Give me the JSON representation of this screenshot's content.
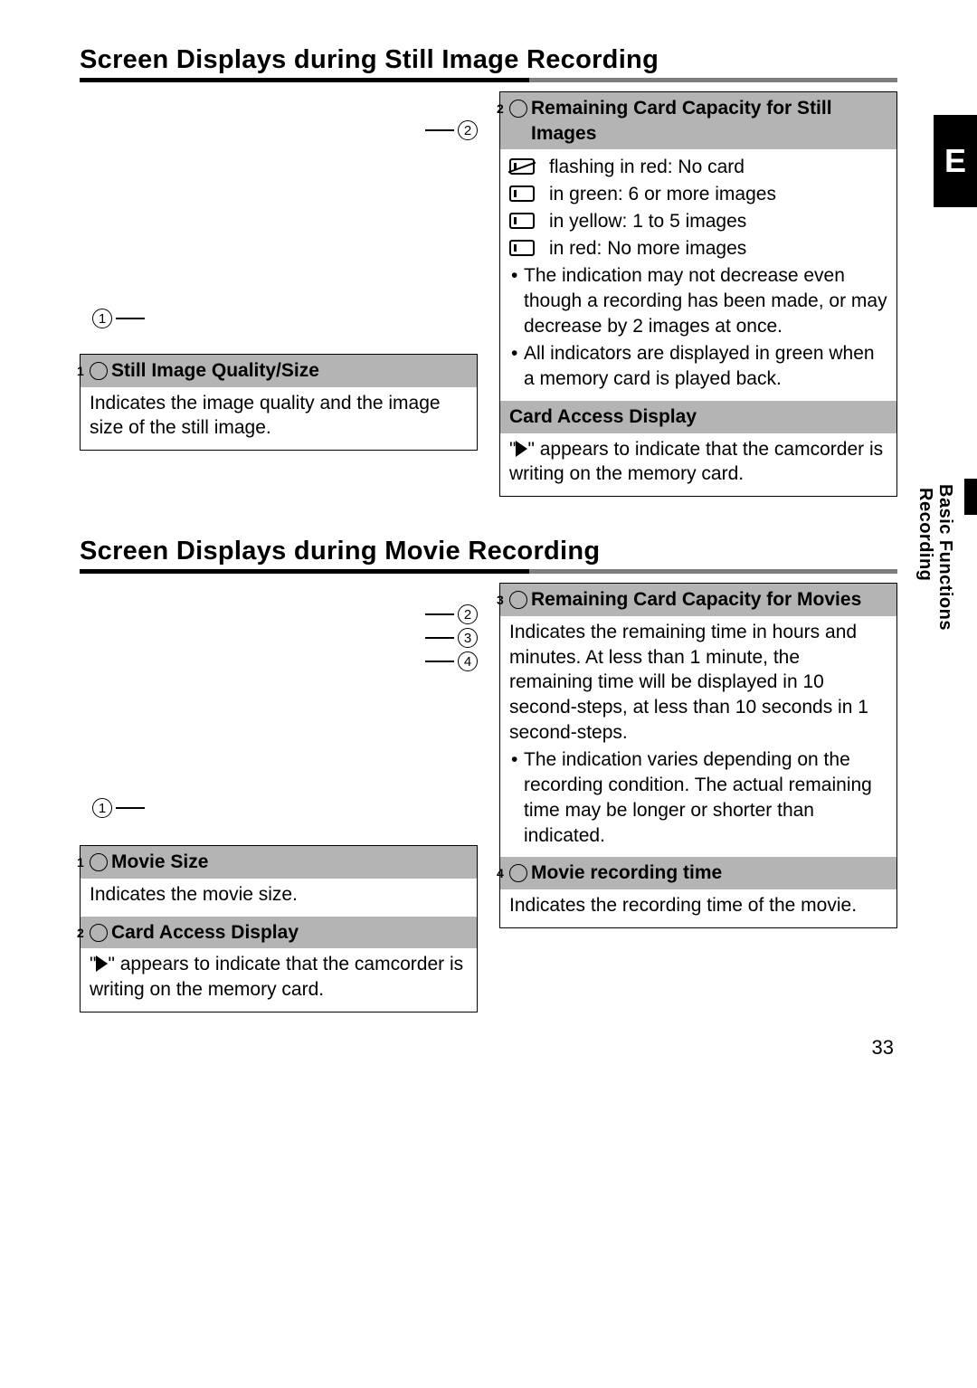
{
  "page_number": "33",
  "edge_tab": "E",
  "side": {
    "line1": "Basic Functions",
    "line2": "Recording"
  },
  "still": {
    "heading": "Screen Displays during Still Image Recording",
    "callouts": {
      "c1": "1",
      "c2": "2"
    },
    "left": {
      "q_title_num": "1",
      "q_title": "Still Image Quality/Size",
      "q_body": "Indicates the image quality and the image size of the still image."
    },
    "right": {
      "cap_title_num": "2",
      "cap_title": "Remaining Card Capacity for Still Images",
      "cap_list": [
        "flashing in red: No card",
        "in green: 6 or more images",
        "in yellow: 1 to 5 images",
        "in red: No more images"
      ],
      "cap_notes": [
        "The indication may not decrease even though a recording has been made, or may decrease by 2 images at once.",
        "All indicators are displayed in green when a memory card is played back."
      ],
      "access_title": "Card Access Display",
      "access_body_pre": "\"",
      "access_body_post": "\" appears to indicate that the camcorder is writing on the memory card."
    }
  },
  "movie": {
    "heading": "Screen Displays during Movie Recording",
    "callouts": {
      "c1": "1",
      "c2": "2",
      "c3": "3",
      "c4": "4"
    },
    "left": {
      "size_num": "1",
      "size_title": "Movie Size",
      "size_body": "Indicates the movie size.",
      "access_num": "2",
      "access_title": "Card Access Display",
      "access_body_pre": "\"",
      "access_body_post": "\" appears to indicate that the camcorder is writing on the memory card."
    },
    "right": {
      "cap_num": "3",
      "cap_title": "Remaining Card Capacity for Movies",
      "cap_body": "Indicates the remaining time in hours and minutes. At less than 1 minute, the remaining time will be displayed in 10 second-steps, at less than 10 seconds in 1 second-steps.",
      "cap_notes": [
        "The indication varies depending on the recording condition. The actual remaining time may be longer or shorter than indicated."
      ],
      "rec_num": "4",
      "rec_title": "Movie recording time",
      "rec_body": "Indicates the recording time of the movie."
    }
  }
}
